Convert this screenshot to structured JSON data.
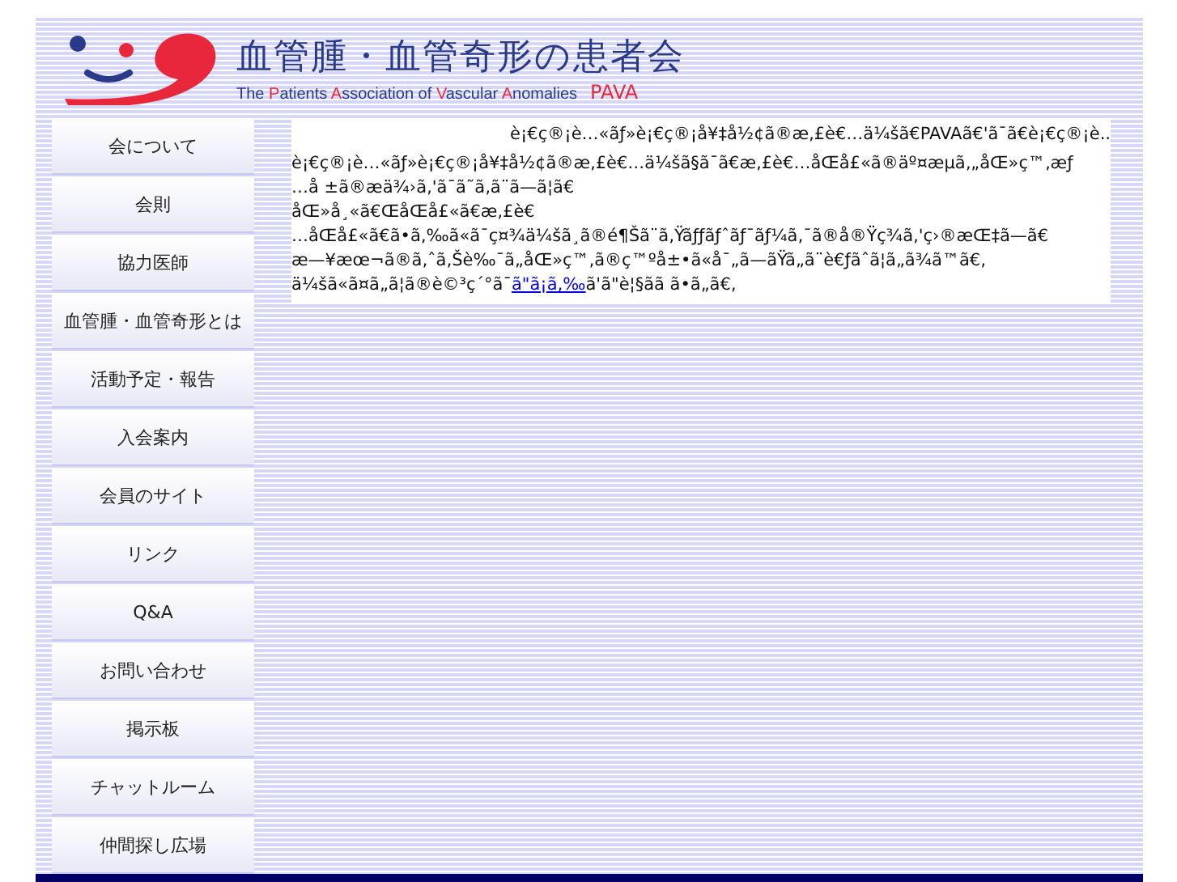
{
  "header": {
    "title": "血管腫・血管奇形の患者会",
    "subtitle_parts": [
      {
        "text": "The ",
        "accent": false
      },
      {
        "text": "P",
        "accent": true
      },
      {
        "text": "atients ",
        "accent": false
      },
      {
        "text": "A",
        "accent": true
      },
      {
        "text": "ssociation of ",
        "accent": false
      },
      {
        "text": "V",
        "accent": true
      },
      {
        "text": "ascular ",
        "accent": false
      },
      {
        "text": "A",
        "accent": true
      },
      {
        "text": "nomalies",
        "accent": false
      }
    ],
    "acronym": "PAVA"
  },
  "menu": [
    {
      "label": "会について"
    },
    {
      "label": "会則"
    },
    {
      "label": "協力医師"
    },
    {
      "label": "血管腫・血管奇形とは"
    },
    {
      "label": "活動予定・報告"
    },
    {
      "label": "入会案内"
    },
    {
      "label": "会員のサイト"
    },
    {
      "label": "リンク"
    },
    {
      "label": "Q&A"
    },
    {
      "label": "お問い合わせ"
    },
    {
      "label": "掲示板"
    },
    {
      "label": "チャットルーム"
    },
    {
      "label": "仲間探し広場"
    }
  ],
  "content": {
    "heading": "è¡€ç®¡è…«ãƒ»è¡€ç®¡å¥‡å½¢ã®æ‚£è€…ä¼šã€PAVAã€'ã¯ã€è¡€ç®¡è..",
    "lines": [
      "è¡€ç®¡è…«ãƒ»è¡€ç®¡å¥‡å½¢ã®æ‚£è€…ä¼šã§ã¯ã€æ‚£è€…åŒå£«ã®äº¤æµã‚„åŒ»ç™‚æƒ",
      "…å ±ã®æä¾›ã‚'ã¯ã˜ã‚ã¨ã—ã¦ã€",
      "åŒ»å¸«ã€ŒåŒå£«ã€æ‚£è€",
      "…åŒå£«ã€ã•ã‚‰ã«ã¯ç¤¾ä¼šã¸ã®é¶Šã¨ã‚Ÿãƒƒãƒˆãƒ¯ãƒ¼ã‚¯ã®å®Ÿç¾ã‚'ç›®æŒ‡ã—ã€",
      "æ—¥æœ¬ã®ã‚ˆã‚Šè‰¯ã„åŒ»ç™‚ã®ç™ºå±•ã«å¯„ã—ãŸã„ã¨è€ƒãˆã¦ã„ã¾ã™ã€‚"
    ],
    "last_line": {
      "before": "ä¼šã«ã¤ã„ã¦ã®è©³ç´°ã¯",
      "link": "ã\"ã¡ã‚‰",
      "after": "ã'ã\"è¦§ãã ã•ã„ã€‚"
    }
  }
}
